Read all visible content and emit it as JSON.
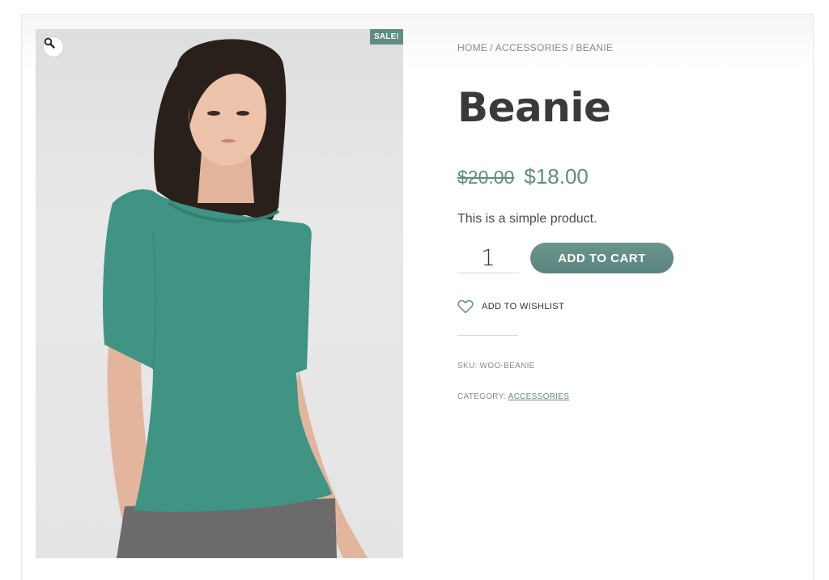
{
  "product": {
    "sale_badge": "SALE!",
    "zoom_icon": "magnifier-icon"
  },
  "breadcrumb": {
    "items": [
      "HOME",
      "ACCESSORIES",
      "BEANIE"
    ],
    "separator": "/"
  },
  "summary": {
    "title": "Beanie",
    "price_old": "$20.00",
    "price_new": "$18.00",
    "short_description": "This is a simple product.",
    "quantity": "1",
    "add_to_cart_label": "ADD TO CART",
    "wishlist_label": "ADD TO WISHLIST",
    "wishlist_icon": "heart-outline-icon"
  },
  "meta": {
    "sku_label": "SKU:",
    "sku_value": "WOO-BEANIE",
    "category_label": "CATEGORY:",
    "category_value": "ACCESSORIES"
  },
  "colors": {
    "accent": "#5f8c84",
    "text": "#3a3a3a",
    "muted": "#8a8a8a",
    "shirt": "#3f9484"
  }
}
